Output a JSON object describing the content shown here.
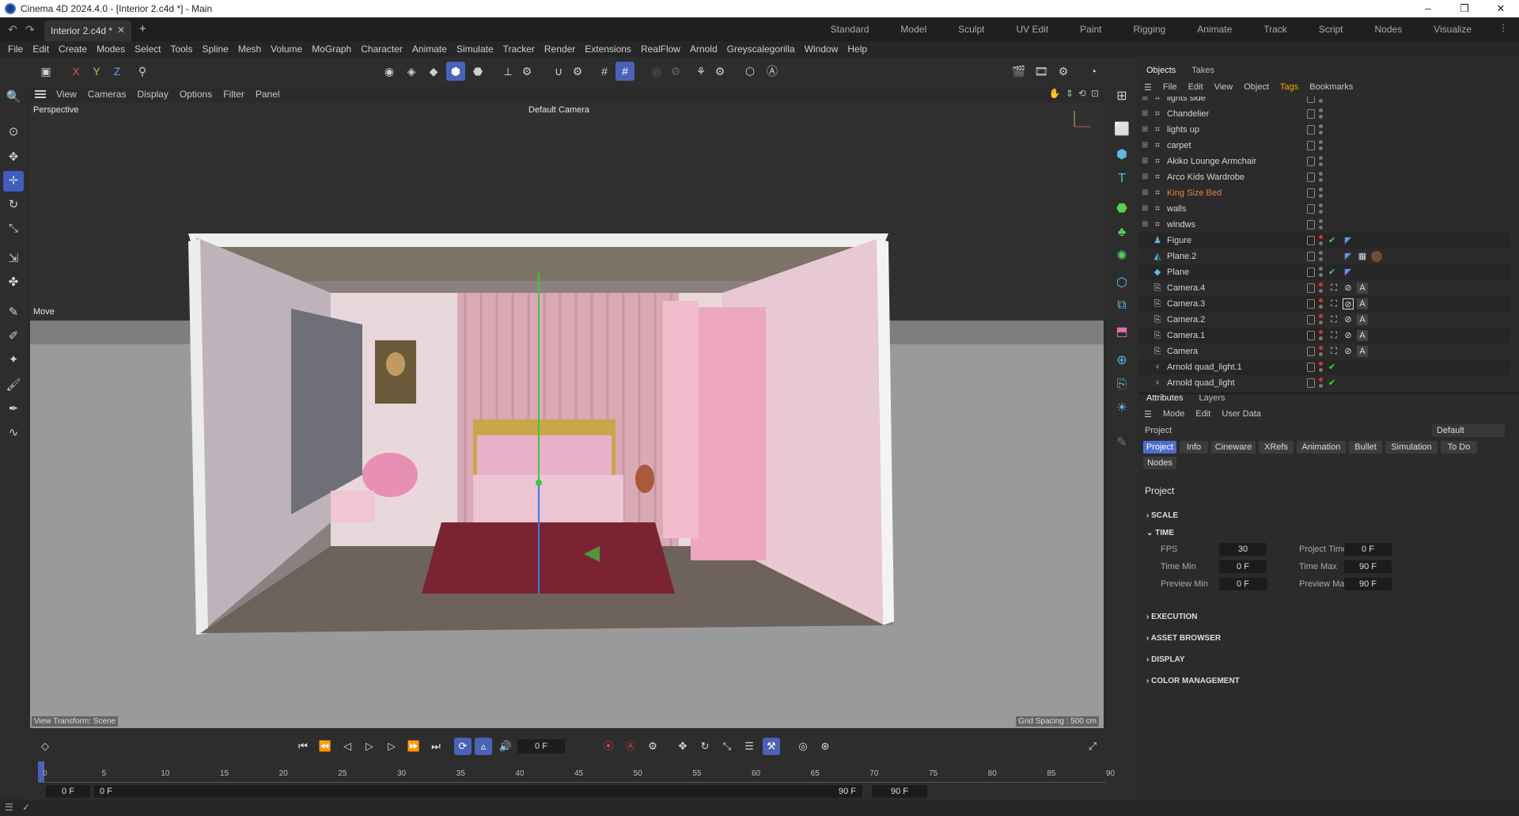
{
  "window": {
    "title": "Cinema 4D 2024.4.0 - [Interior 2.c4d *] - Main",
    "minimize": "–",
    "maximize": "❐",
    "close": "✕"
  },
  "tabs": {
    "doc": "Interior 2.c4d *",
    "close": "✕",
    "add": "+"
  },
  "layouts": [
    "Standard",
    "Model",
    "Sculpt",
    "UV Edit",
    "Paint",
    "Rigging",
    "Animate",
    "Track",
    "Script",
    "Nodes",
    "Visualize"
  ],
  "menu": [
    "File",
    "Edit",
    "Create",
    "Modes",
    "Select",
    "Tools",
    "Spline",
    "Mesh",
    "Volume",
    "MoGraph",
    "Character",
    "Animate",
    "Simulate",
    "Tracker",
    "Render",
    "Extensions",
    "RealFlow",
    "Arnold",
    "Greyscalegorilla",
    "Window",
    "Help"
  ],
  "axis": {
    "x": "X",
    "y": "Y",
    "z": "Z"
  },
  "viewport": {
    "menu": [
      "View",
      "Cameras",
      "Display",
      "Options",
      "Filter",
      "Panel"
    ],
    "label": "Perspective",
    "camera": "Default Camera",
    "mode": "Move",
    "transform": "View Transform: Scene",
    "grid": "Grid Spacing : 500 cm"
  },
  "objects_panel": {
    "tabs": [
      "Objects",
      "Takes"
    ],
    "menu": [
      "File",
      "Edit",
      "View",
      "Object",
      "Tags",
      "Bookmarks"
    ],
    "items": [
      {
        "name": "lights side"
      },
      {
        "name": "Chandelier"
      },
      {
        "name": "lights up"
      },
      {
        "name": "carpet"
      },
      {
        "name": "Akiko Lounge Armchair"
      },
      {
        "name": "Arco Kids Wardrobe"
      },
      {
        "name": "King Size Bed"
      },
      {
        "name": "walls"
      },
      {
        "name": "windws"
      },
      {
        "name": "Figure"
      },
      {
        "name": "Plane.2"
      },
      {
        "name": "Plane"
      },
      {
        "name": "Camera.4"
      },
      {
        "name": "Camera.3"
      },
      {
        "name": "Camera.2"
      },
      {
        "name": "Camera.1"
      },
      {
        "name": "Camera"
      },
      {
        "name": "Arnold quad_light.1"
      },
      {
        "name": "Arnold quad_light"
      }
    ]
  },
  "attributes_panel": {
    "tabs": [
      "Attributes",
      "Layers"
    ],
    "menu": [
      "Mode",
      "Edit",
      "User Data"
    ],
    "object": "Project",
    "preset": "Default",
    "chips": [
      "Project",
      "Info",
      "Cineware",
      "XRefs",
      "Animation",
      "Bullet",
      "Simulation",
      "To Do",
      "Nodes"
    ],
    "section": "Project",
    "groups": {
      "scale": "SCALE",
      "time": "TIME",
      "execution": "EXECUTION",
      "asset_browser": "ASSET BROWSER",
      "display": "DISPLAY",
      "color_management": "COLOR MANAGEMENT"
    },
    "fields": {
      "fps_label": "FPS",
      "fps": "30",
      "project_time_label": "Project Time",
      "project_time": "0 F",
      "time_min_label": "Time Min",
      "time_min": "0 F",
      "time_max_label": "Time Max",
      "time_max": "90 F",
      "preview_min_label": "Preview Min",
      "preview_min": "0 F",
      "preview_max_label": "Preview Max",
      "preview_max": "90 F"
    }
  },
  "timeline": {
    "current_frame": "0 F",
    "ticks": [
      "0",
      "5",
      "10",
      "15",
      "20",
      "25",
      "30",
      "35",
      "40",
      "45",
      "50",
      "55",
      "60",
      "65",
      "70",
      "75",
      "80",
      "85",
      "90"
    ],
    "start": "0 F",
    "preview_start": "0 F",
    "preview_end": "90 F",
    "end": "90 F"
  }
}
